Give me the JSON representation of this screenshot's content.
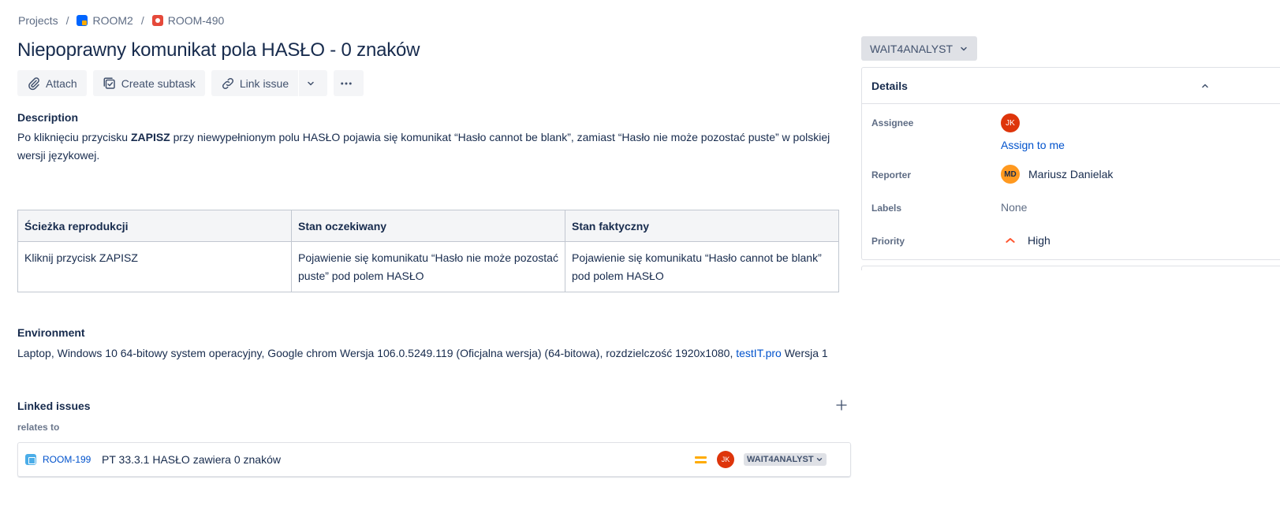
{
  "breadcrumb": {
    "projects": "Projects",
    "project": "ROOM2",
    "issue_key": "ROOM-490",
    "separator": "/"
  },
  "issue": {
    "title": "Niepoprawny komunikat pola HASŁO - 0 znaków",
    "status": "WAIT4ANALYST"
  },
  "toolbar": {
    "attach": "Attach",
    "create_subtask": "Create subtask",
    "link_issue": "Link issue"
  },
  "description": {
    "label": "Description",
    "part1": "Po kliknięciu przycisku ",
    "bold": "ZAPISZ",
    "part2": " przy niewypełnionym polu HASŁO pojawia się komunikat “Hasło cannot be blank”, zamiast “Hasło nie może pozostać puste” w polskiej wersji językowej."
  },
  "table": {
    "headers": [
      "Ścieżka reprodukcji",
      "Stan oczekiwany",
      "Stan faktyczny"
    ],
    "rows": [
      [
        "Kliknij przycisk ZAPISZ",
        "Pojawienie się komunikatu “Hasło nie może pozostać puste” pod polem HASŁO",
        "Pojawienie się komunikatu “Hasło cannot be blank” pod polem HASŁO"
      ]
    ]
  },
  "environment": {
    "label": "Environment",
    "text": "Laptop, Windows 10 64-bitowy system operacyjny, Google chrom Wersja 106.0.5249.119 (Oficjalna wersja) (64-bitowa), rozdzielczość 1920x1080, ",
    "link": "testIT.pro",
    "suffix": " Wersja 1"
  },
  "linked_issues": {
    "label": "Linked issues",
    "relation": "relates to",
    "items": [
      {
        "key": "ROOM-199",
        "summary": "PT 33.3.1 HASŁO zawiera 0 znaków",
        "priority_icon": "medium-priority-icon",
        "assignee_initials": "JK",
        "status": "WAIT4ANALYST"
      }
    ]
  },
  "details": {
    "header": "Details",
    "assignee_label": "Assignee",
    "assignee_initials": "JK",
    "assign_to_me": "Assign to me",
    "reporter_label": "Reporter",
    "reporter_initials": "MD",
    "reporter_name": "Mariusz Danielak",
    "labels_label": "Labels",
    "labels_value": "None",
    "priority_label": "Priority",
    "priority_value": "High"
  },
  "colors": {
    "text": "#172b4d",
    "link": "#0052cc",
    "avatar_jk": "#de350b",
    "avatar_md": "#ff991f",
    "priority_high": "#ff5630",
    "priority_medium": "#ffab00"
  }
}
